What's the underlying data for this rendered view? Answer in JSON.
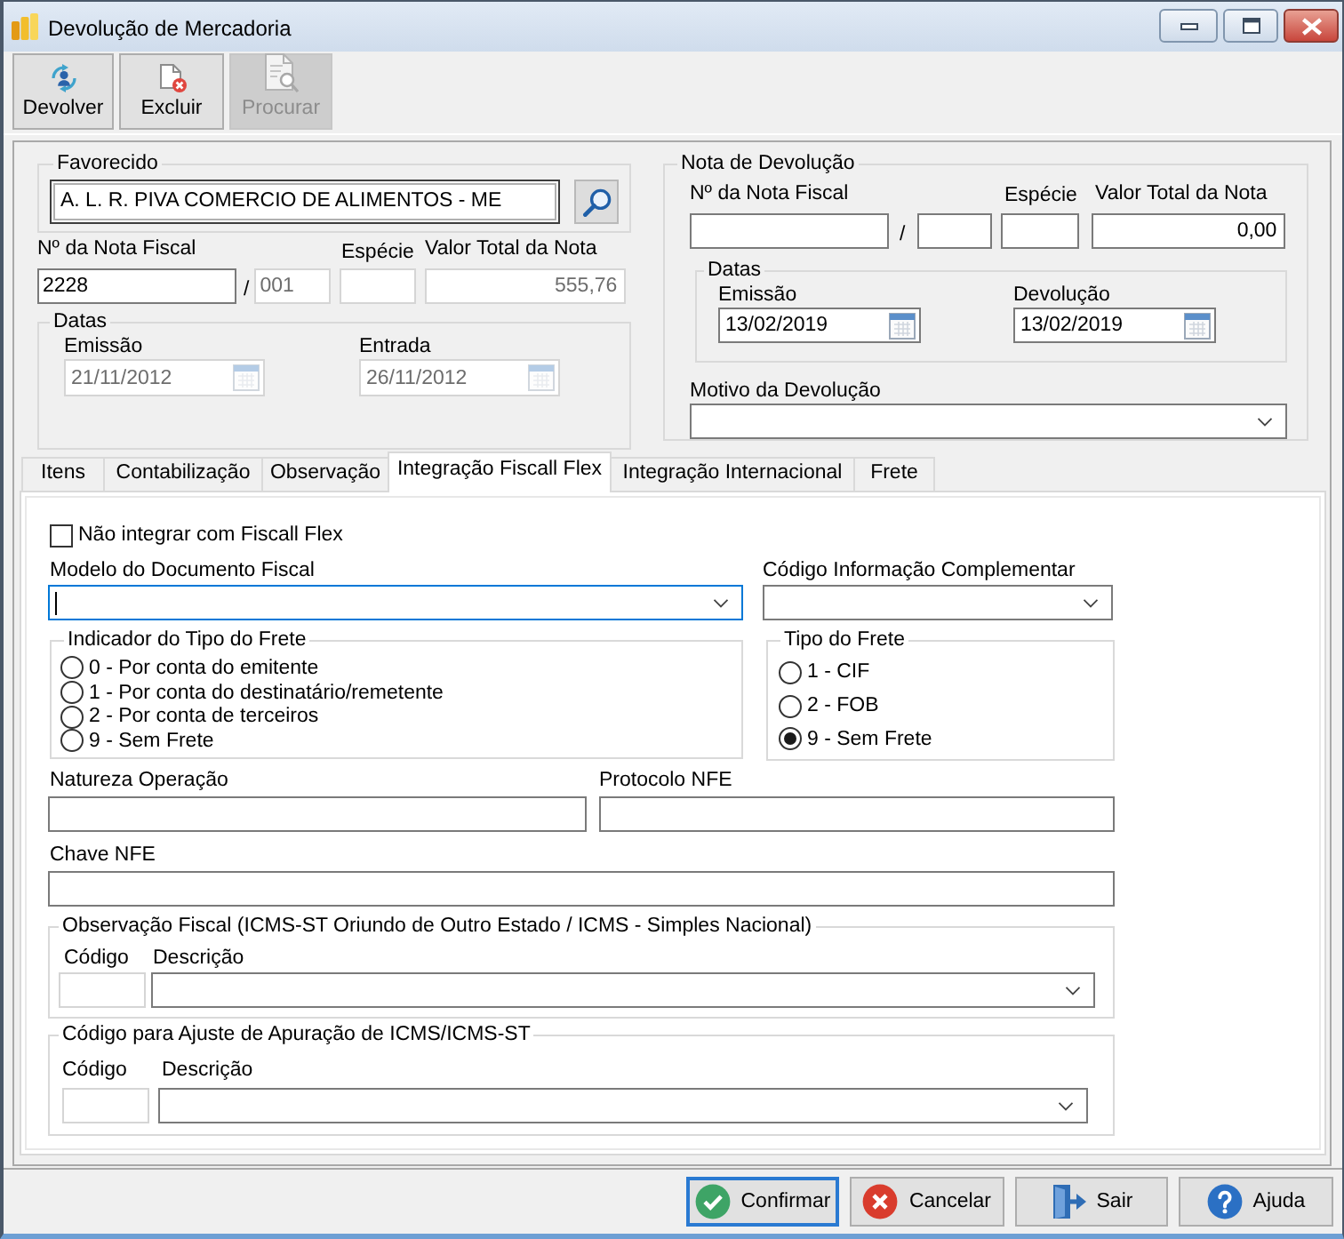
{
  "window": {
    "title": "Devolução de Mercadoria"
  },
  "toolbar": [
    {
      "label": "Devolver",
      "kind": "return",
      "disabled": false
    },
    {
      "label": "Excluir",
      "kind": "delete",
      "disabled": false
    },
    {
      "label": "Procurar",
      "kind": "search",
      "disabled": true
    }
  ],
  "origem": {
    "favorecido": {
      "title": "Favorecido",
      "value": "A. L. R. PIVA COMERCIO DE ALIMENTOS - ME"
    },
    "numero": {
      "label": "Nº da Nota Fiscal",
      "value": "2228",
      "disabled": false
    },
    "separator": "/",
    "serie": {
      "value": "001",
      "disabled": true
    },
    "especie": {
      "label": "Espécie",
      "disabled": true
    },
    "valor_total": {
      "label": "Valor Total da Nota",
      "value": "555,76",
      "disabled": true
    },
    "datas": {
      "title": "Datas",
      "emissao": {
        "label": "Emissão",
        "value": "21/11/2012",
        "disabled": true
      },
      "entrada": {
        "label": "Entrada",
        "value": "26/11/2012",
        "disabled": true
      }
    }
  },
  "nota_devolucao": {
    "title": "Nota de Devolução",
    "numero": {
      "label": "Nº da Nota Fiscal",
      "disabled": false
    },
    "separator": "/",
    "serie": {
      "disabled": false
    },
    "especie": {
      "label": "Espécie",
      "disabled": false
    },
    "valor_total": {
      "label": "Valor Total da Nota",
      "value": "0,00",
      "disabled": false
    },
    "datas": {
      "title": "Datas",
      "emissao": {
        "label": "Emissão",
        "value": "13/02/2019",
        "disabled": false
      },
      "devolucao": {
        "label": "Devolução",
        "value": "13/02/2019",
        "disabled": false
      }
    },
    "motivo": {
      "label": "Motivo da Devolução"
    }
  },
  "tabs": [
    {
      "label": "Itens",
      "selected": false
    },
    {
      "label": "Contabilização",
      "selected": false
    },
    {
      "label": "Observação",
      "selected": false
    },
    {
      "label": "Integração Fiscall Flex",
      "selected": true
    },
    {
      "label": "Integração Internacional",
      "selected": false
    },
    {
      "label": "Frete",
      "selected": false
    }
  ],
  "fiscall_flex": {
    "nao_integrar": {
      "label": "Não integrar com Fiscall Flex",
      "checked": false
    },
    "modelo_documento": {
      "label": "Modelo do Documento Fiscal",
      "focused": true
    },
    "codigo_informacao": {
      "label": "Código Informação Complementar",
      "focused": false
    },
    "indicador_frete": {
      "title": "Indicador do Tipo do Frete",
      "options": [
        {
          "label": "0 - Por conta do emitente",
          "selected": false
        },
        {
          "label": "1 - Por conta do destinatário/remetente",
          "selected": false
        },
        {
          "label": "2 - Por conta de terceiros",
          "selected": false
        },
        {
          "label": "9 - Sem Frete",
          "selected": false
        }
      ]
    },
    "tipo_frete": {
      "title": "Tipo do Frete",
      "options": [
        {
          "label": "1 - CIF",
          "selected": false
        },
        {
          "label": "2 - FOB",
          "selected": false
        },
        {
          "label": "9 - Sem Frete",
          "selected": true
        }
      ]
    },
    "natureza_operacao": {
      "label": "Natureza Operação"
    },
    "protocolo_nfe": {
      "label": "Protocolo NFE"
    },
    "chave_nfe": {
      "label": "Chave NFE"
    },
    "observacao_fiscal": {
      "title": "Observação Fiscal (ICMS-ST Oriundo de Outro Estado / ICMS - Simples Nacional)",
      "codigo": {
        "label": "Código",
        "disabled": true
      },
      "descricao": {
        "label": "Descrição"
      }
    },
    "ajuste_apuracao": {
      "title": "Código para Ajuste de Apuração de ICMS/ICMS-ST",
      "codigo": {
        "label": "Código",
        "disabled": true
      },
      "descricao": {
        "label": "Descrição"
      }
    }
  },
  "actions": [
    {
      "label": "Confirmar",
      "kind": "confirm",
      "focused": true
    },
    {
      "label": "Cancelar",
      "kind": "cancel",
      "focused": false
    },
    {
      "label": "Sair",
      "kind": "exit",
      "focused": false
    },
    {
      "label": "Ajuda",
      "kind": "help",
      "focused": false
    }
  ]
}
